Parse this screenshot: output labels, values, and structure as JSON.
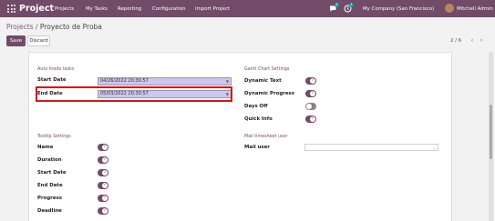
{
  "navbar": {
    "app_name": "Project",
    "menu": [
      "Projects",
      "My Tasks",
      "Reporting",
      "Configuration",
      "Import Project"
    ],
    "messages_count": "6",
    "activities_count": "4",
    "company": "My Company (San Francisco)",
    "user": "Mitchell Admin"
  },
  "breadcrumb": {
    "root": "Projects",
    "separator": "/",
    "current": "Proyecto de Proba"
  },
  "buttons": {
    "save": "Save",
    "discard": "Discard"
  },
  "pager": {
    "value": "2 / 6"
  },
  "auto_mode": {
    "title": "Auto mode tasks",
    "start_label": "Start Date",
    "start_value": "04/26/2022 20:30:57",
    "end_label": "End Date",
    "end_value": "05/03/2022 20:30:57"
  },
  "gantt": {
    "title": "Gantt Chart Settings",
    "items": [
      {
        "label": "Dynamic Text",
        "on": true
      },
      {
        "label": "Dynamic Progress",
        "on": true
      },
      {
        "label": "Days Off",
        "on": false
      },
      {
        "label": "Quick Info",
        "on": true
      }
    ]
  },
  "tooltip": {
    "title": "Tooltip Settings",
    "items": [
      {
        "label": "Name",
        "on": true
      },
      {
        "label": "Duration",
        "on": true
      },
      {
        "label": "Start Date",
        "on": true
      },
      {
        "label": "End Date",
        "on": true
      },
      {
        "label": "Progress",
        "on": true
      },
      {
        "label": "Deadline",
        "on": true
      }
    ]
  },
  "mail_timesheet": {
    "title": "Mail timesheet user",
    "label": "Mail user",
    "value": ""
  },
  "colors": {
    "brand": "#714b67",
    "highlight": "#d11a1a",
    "date_bg": "#cdc6ef",
    "toggle_off": "#888888"
  }
}
